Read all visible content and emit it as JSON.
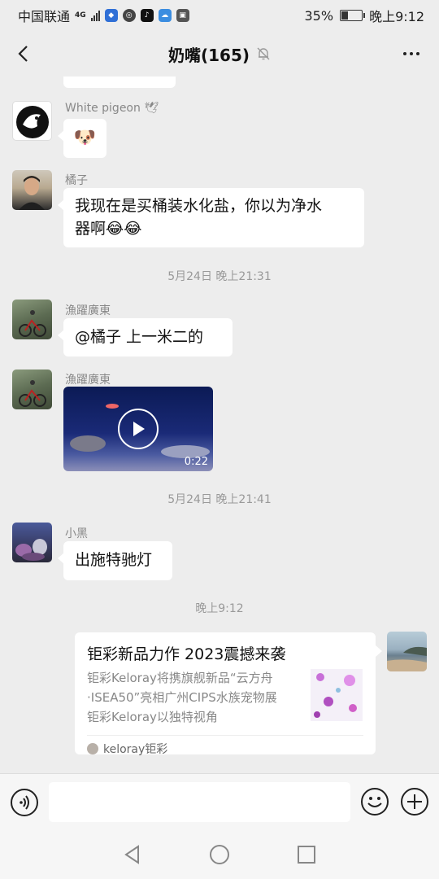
{
  "status_bar": {
    "carrier": "中国联通",
    "network": "4G",
    "battery": "35%",
    "battery_level": 0.35,
    "time": "晚上9:12"
  },
  "header": {
    "title": "奶嘴(165)",
    "mute_icon": "bell-off-icon",
    "more_icon": "more-icon"
  },
  "messages": [
    {
      "sender": "White pigeon 🕊",
      "text": "🐶"
    },
    {
      "sender": "橘子",
      "text_line1": "我现在是买桶装水化盐，你以为净水",
      "text_line2": "器啊😂😂"
    },
    {
      "time": "5月24日 晚上21:31"
    },
    {
      "sender": "漁躍廣東",
      "text": "@橘子  上一米二的"
    },
    {
      "sender": "漁躍廣東",
      "video_duration": "0:22"
    },
    {
      "time": "5月24日 晚上21:41"
    },
    {
      "sender": "小黑",
      "text": "出施特驰灯"
    },
    {
      "time": "晚上9:12"
    },
    {
      "link_card": {
        "title": "钜彩新品力作 2023震撼来袭",
        "desc_line1": "钜彩Keloray将携旗舰新品“云方舟",
        "desc_line2": "·ISEA50”亮相广州CIPS水族宠物展",
        "desc_line3": "钜彩Keloray以独特视角",
        "source": "keloray钜彩"
      }
    }
  ],
  "input_bar": {
    "voice_icon": "voice-icon",
    "emoji_icon": "emoji-icon",
    "plus_icon": "plus-icon"
  },
  "nav": {
    "back": "triangle-back-icon",
    "home": "circle-home-icon",
    "recents": "square-recents-icon"
  }
}
